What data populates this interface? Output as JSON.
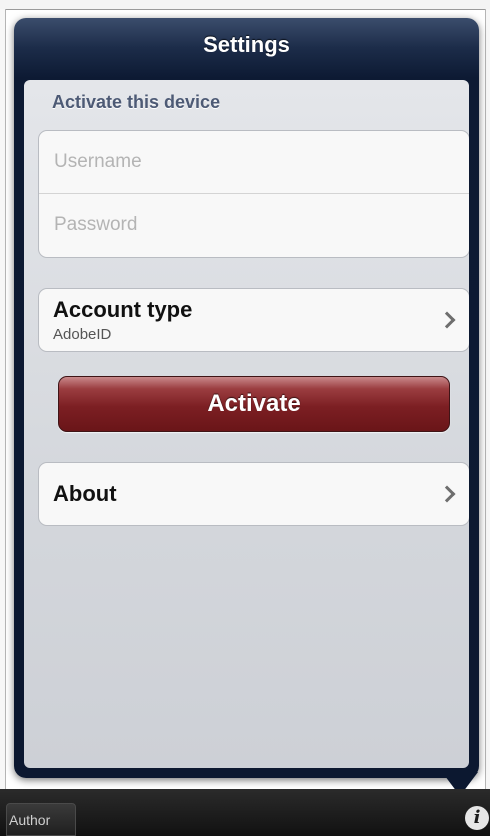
{
  "popover": {
    "title": "Settings"
  },
  "activation": {
    "section_header": "Activate this device",
    "username_placeholder": "Username",
    "password_placeholder": "Password",
    "account_type_label": "Account type",
    "account_type_value": "AdobeID",
    "activate_label": "Activate",
    "about_label": "About"
  },
  "toolbar": {
    "author_label": "Author",
    "info_glyph": "i"
  },
  "colors": {
    "popover_header": "#0d1a33",
    "activate_button": "#7c1f23",
    "section_header_text": "#4d5a75"
  },
  "icons": [
    "chevron-right-icon",
    "info-icon"
  ]
}
